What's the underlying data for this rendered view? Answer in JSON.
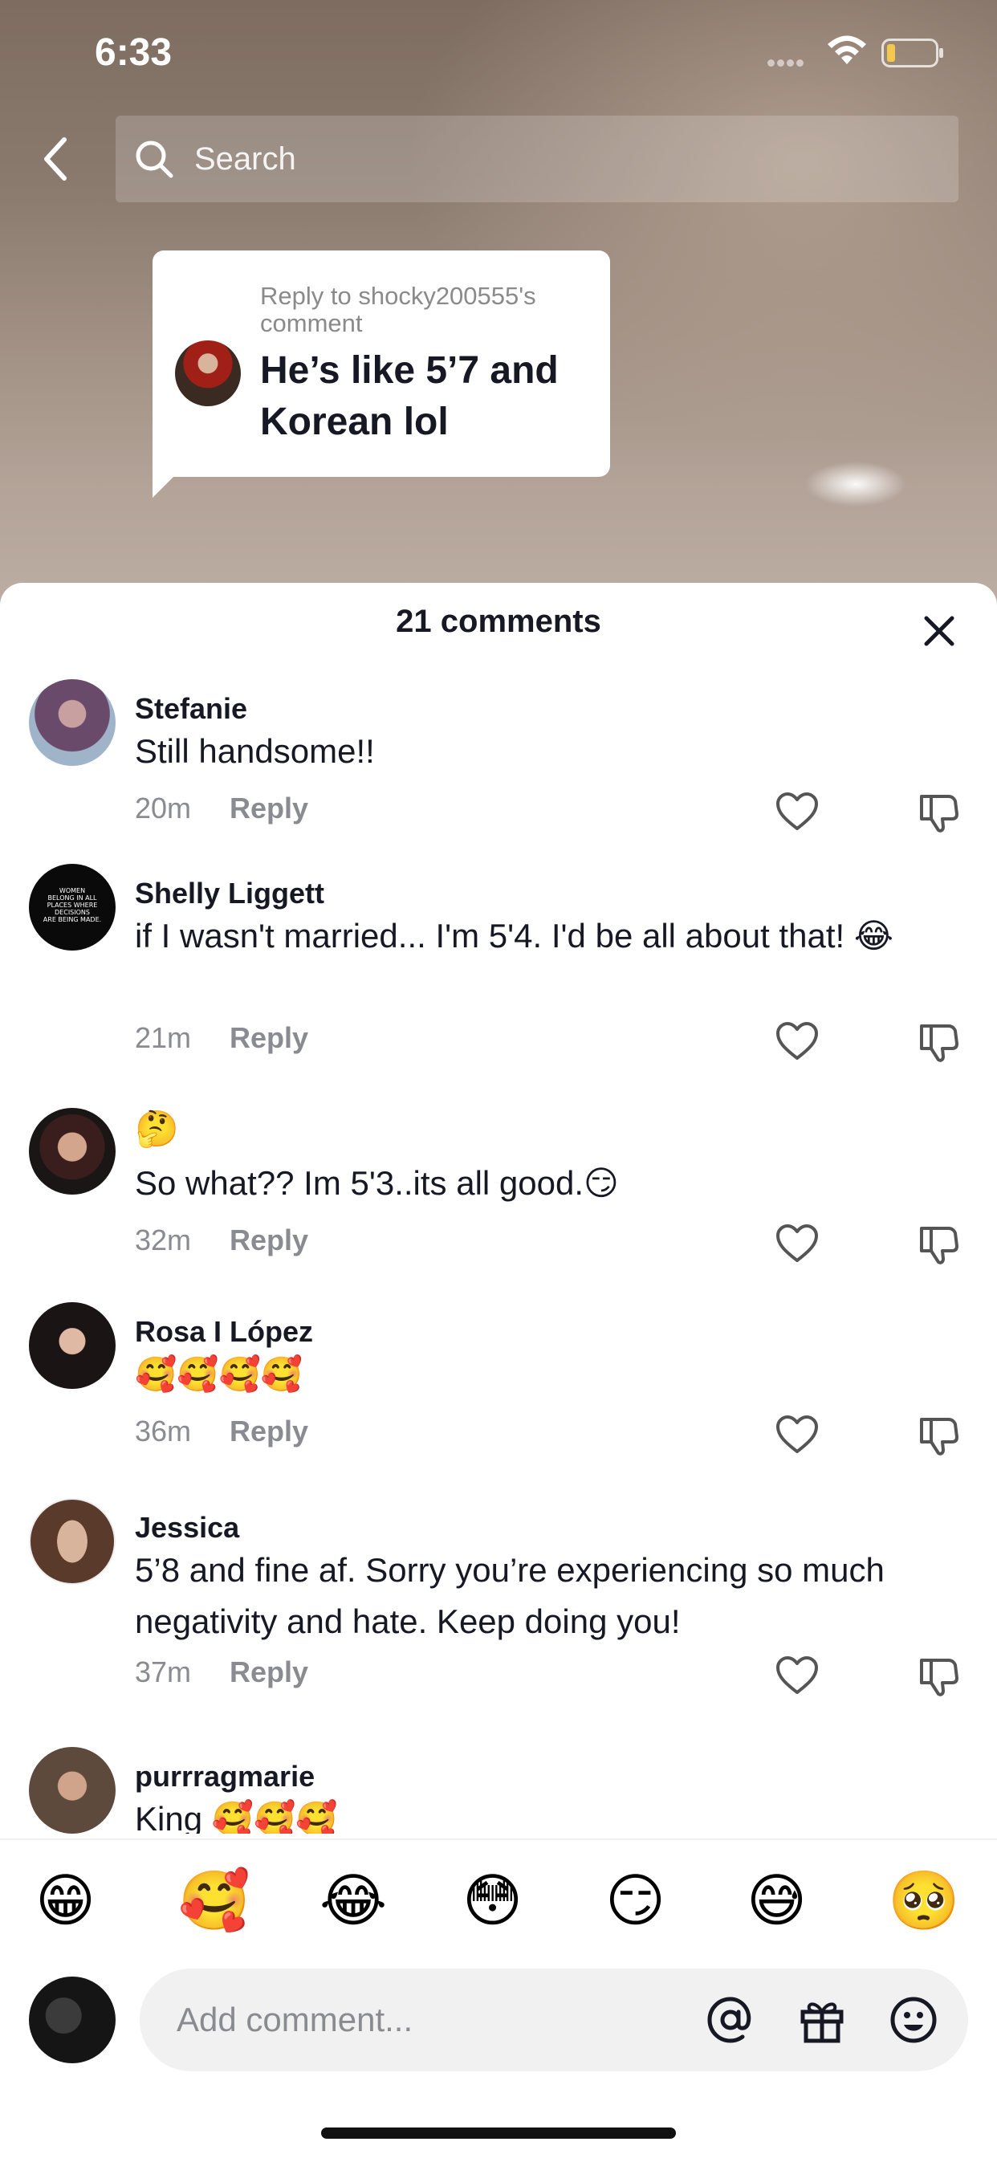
{
  "status_bar": {
    "time": "6:33"
  },
  "search": {
    "placeholder": "Search"
  },
  "reply_bubble": {
    "reply_to": "Reply to shocky200555's comment",
    "text": "He’s like 5’7 and Korean lol"
  },
  "sheet": {
    "title": "21 comments"
  },
  "comments": [
    {
      "username": "Stefanie",
      "text": "Still handsome!!",
      "time": "20m",
      "reply_label": "Reply"
    },
    {
      "username": "Shelly Liggett",
      "text": "if I wasn't married... I'm 5'4. I'd be all about that! 😂",
      "time": "21m",
      "reply_label": "Reply"
    },
    {
      "username": "🤔",
      "text": "So what?? Im 5'3..its all good.😏",
      "time": "32m",
      "reply_label": "Reply"
    },
    {
      "username": "Rosa I López",
      "text": "🥰🥰🥰🥰",
      "time": "36m",
      "reply_label": "Reply"
    },
    {
      "username": "Jessica",
      "text": "5’8 and fine af. Sorry you’re experiencing so much negativity and hate. Keep doing you!",
      "time": "37m",
      "reply_label": "Reply"
    },
    {
      "username": "purrragmarie",
      "text": "King 🥰🥰🥰"
    }
  ],
  "shelly_avatar_text": "WOMEN BELONG IN ALL PLACES WHERE DECISIONS ARE BEING MADE.",
  "quick_emojis": [
    "😁",
    "🥰",
    "😂",
    "😳",
    "😏",
    "😅",
    "🥺"
  ],
  "composer": {
    "placeholder": "Add comment..."
  },
  "icons": {
    "back": "chevron-left-icon",
    "search": "search-icon",
    "close": "close-icon",
    "like": "heart-outline-icon",
    "dislike": "thumbs-down-icon",
    "mention": "at-icon",
    "gift": "gift-icon",
    "emoji": "smiley-icon"
  },
  "colors": {
    "text": "#161823",
    "muted": "#8a8b91",
    "battery_level": "#f2c94c"
  }
}
